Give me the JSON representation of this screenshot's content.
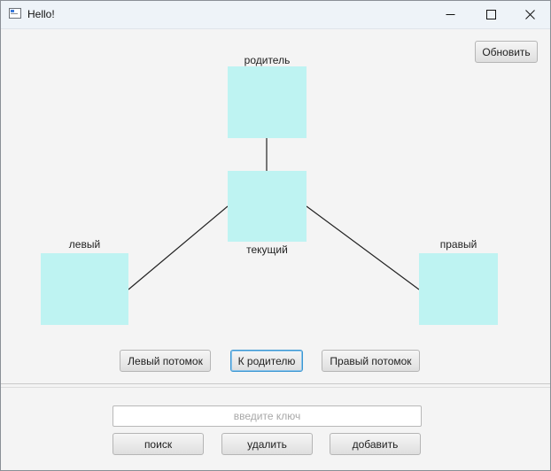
{
  "window": {
    "title": "Hello!"
  },
  "toolbar": {
    "refresh_label": "Обновить"
  },
  "tree": {
    "parent_label": "родитель",
    "current_label": "текущий",
    "left_label": "левый",
    "right_label": "правый",
    "node_color": "#bef3f2"
  },
  "navigation": {
    "left_child_label": "Левый потомок",
    "to_parent_label": "К родителю",
    "right_child_label": "Правый потомок"
  },
  "actions": {
    "key_placeholder": "введите ключ",
    "key_value": "",
    "search_label": "поиск",
    "delete_label": "удалить",
    "add_label": "добавить"
  }
}
